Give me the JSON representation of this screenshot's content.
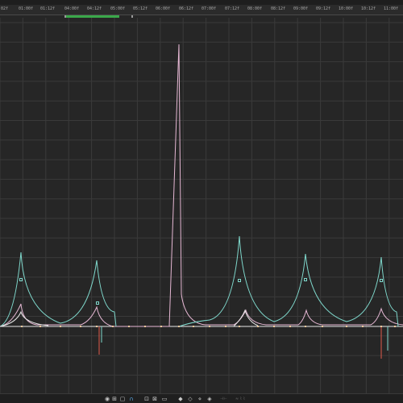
{
  "ruler": {
    "ticks": [
      "02f",
      "01:00f",
      "01:12f",
      "04:00f",
      "04:12f",
      "05:00f",
      "05:12f",
      "06:00f",
      "06:12f",
      "07:00f",
      "07:12f",
      "08:00f",
      "08:12f",
      "09:00f",
      "09:12f",
      "10:00f",
      "10:12f",
      "11:00f"
    ]
  },
  "colors": {
    "background": "#262626",
    "grid": "#3a3a3a",
    "curve_pink": "#e6b8d4",
    "curve_cyan": "#7fd8cc",
    "curve_white": "#e8e8e8",
    "curve_red": "#e05a4a",
    "work_area": "#3aa84a"
  },
  "toolbar": {
    "buttons": [
      {
        "name": "eye-icon",
        "glyph": "◉"
      },
      {
        "name": "graph-icon",
        "glyph": "⊞"
      },
      {
        "name": "frame-icon",
        "glyph": "▢"
      },
      {
        "name": "snap-icon",
        "glyph": "∩",
        "active": true
      },
      {
        "name": "fit-selection-icon",
        "glyph": "⊡"
      },
      {
        "name": "fit-all-icon",
        "glyph": "⊠"
      },
      {
        "name": "timeline-icon",
        "glyph": "▭"
      },
      {
        "name": "edit-keyframe-icon",
        "glyph": "◆"
      },
      {
        "name": "hold-icon",
        "glyph": "◇"
      },
      {
        "name": "linear-icon",
        "glyph": "⋄"
      },
      {
        "name": "auto-bezier-icon",
        "glyph": "◈"
      }
    ],
    "labels": [
      "⊣⊢",
      "≈ ⌇ ⌇"
    ]
  }
}
